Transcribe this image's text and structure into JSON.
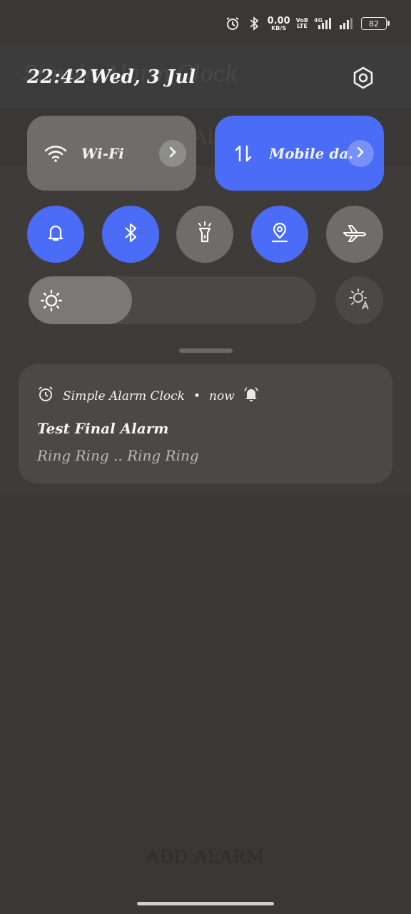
{
  "background": {
    "faint_title": "Simple Alarm Clock",
    "faint_subtitle": "No Alarms",
    "add_alarm": "ADD ALARM"
  },
  "status_bar": {
    "net_speed_value": "0.00",
    "net_speed_unit": "KB/S",
    "volte_top": "VoB",
    "volte_bottom": "LTE",
    "network_type": "4G",
    "battery": "82",
    "icons": [
      "alarm-icon",
      "bluetooth-icon",
      "signal-icon",
      "signal-icon",
      "battery-icon"
    ]
  },
  "header": {
    "time": "22:42",
    "date": "Wed, 3 Jul"
  },
  "tiles": {
    "wifi_label": "Wi-Fi",
    "mobile_label": "Mobile da.."
  },
  "toggles": [
    {
      "name": "sound",
      "icon": "bell-icon",
      "on": true
    },
    {
      "name": "bluetooth",
      "icon": "bluetooth-icon",
      "on": true
    },
    {
      "name": "flashlight",
      "icon": "flashlight-icon",
      "on": false
    },
    {
      "name": "location",
      "icon": "location-icon",
      "on": true
    },
    {
      "name": "airplane",
      "icon": "airplane-icon",
      "on": false
    }
  ],
  "brightness": {
    "level": 0.36
  },
  "notification": {
    "app_name": "Simple Alarm Clock",
    "separator": "•",
    "time": "now",
    "title": "Test Final Alarm",
    "body": "Ring Ring .. Ring Ring"
  },
  "colors": {
    "accent": "#4a6cf7",
    "tile_off": "#6e6d6c",
    "panel": "#4a4948",
    "background": "#353535"
  }
}
